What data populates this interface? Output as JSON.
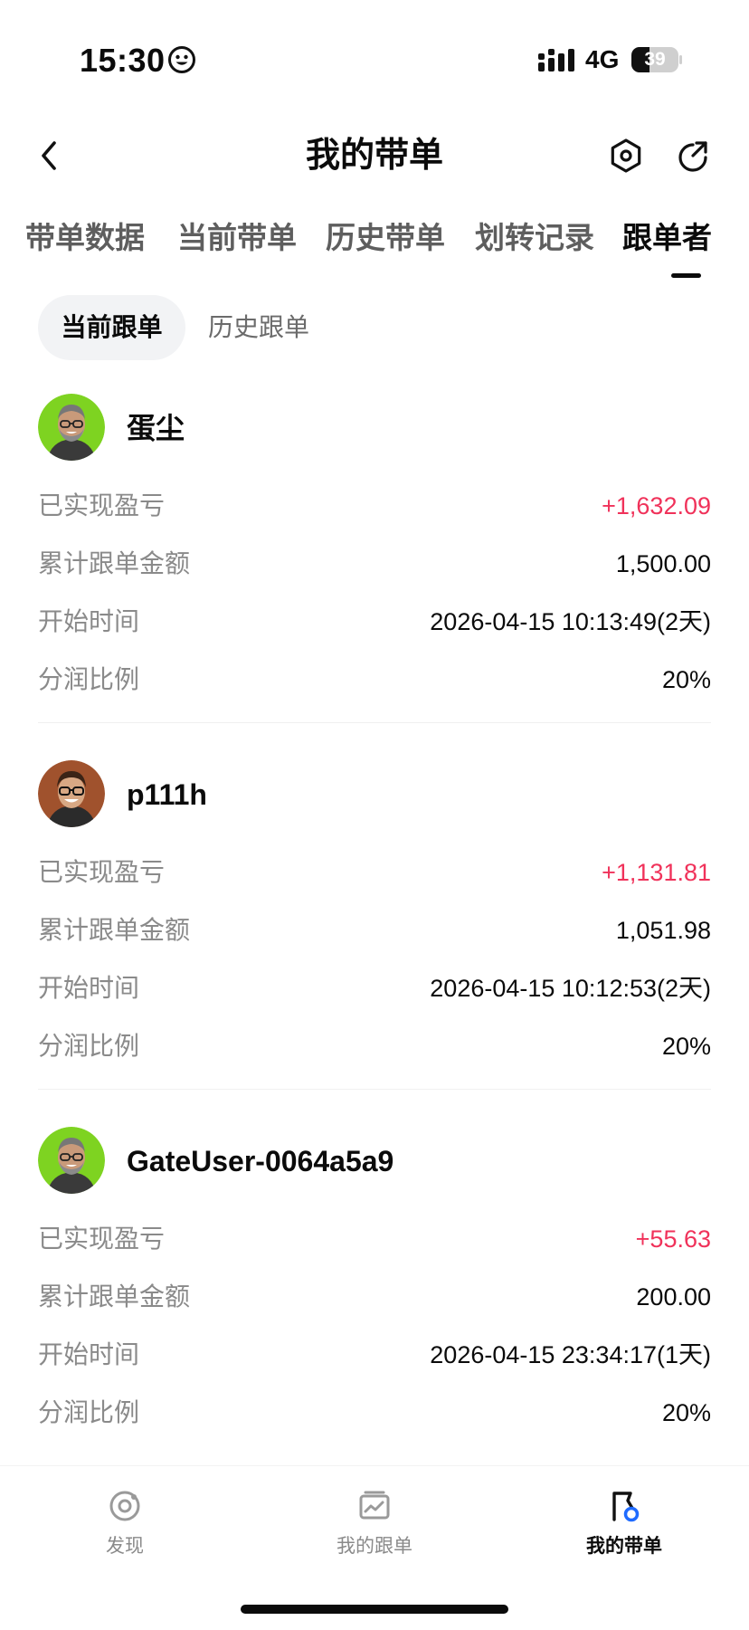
{
  "status_bar": {
    "time": "15:30",
    "network": "4G",
    "battery": "39",
    "battery_level": 0.39,
    "emoji_icon": "smiley-face-icon",
    "signal_icon": "cellular-signal-icon"
  },
  "header": {
    "title": "我的带单",
    "back_icon": "chevron-left-icon",
    "settings_icon": "hexagon-settings-icon",
    "share_icon": "share-arrow-icon"
  },
  "main_tabs": [
    {
      "label": "带单数据",
      "active": false
    },
    {
      "label": "当前带单",
      "active": false
    },
    {
      "label": "历史带单",
      "active": false
    },
    {
      "label": "划转记录",
      "active": false
    },
    {
      "label": "跟单者",
      "active": true
    }
  ],
  "sub_tabs": [
    {
      "label": "当前跟单",
      "active": true
    },
    {
      "label": "历史跟单",
      "active": false
    }
  ],
  "labels": {
    "pnl": "已实现盈亏",
    "amount": "累计跟单金额",
    "start_time": "开始时间",
    "share_ratio": "分润比例"
  },
  "followers": [
    {
      "name": "蛋尘",
      "avatar_bg": "#7ed321",
      "pnl": "+1,632.09",
      "amount": "1,500.00",
      "start_time": "2026-04-15 10:13:49(2天)",
      "share_ratio": "20%"
    },
    {
      "name": "p111h",
      "avatar_bg": "#a0522d",
      "pnl": "+1,131.81",
      "amount": "1,051.98",
      "start_time": "2026-04-15 10:12:53(2天)",
      "share_ratio": "20%"
    },
    {
      "name": "GateUser-0064a5a9",
      "avatar_bg": "#7ed321",
      "pnl": "+55.63",
      "amount": "200.00",
      "start_time": "2026-04-15 23:34:17(1天)",
      "share_ratio": "20%"
    }
  ],
  "bottom_nav": [
    {
      "label": "发现",
      "icon": "discover-target-icon",
      "active": false
    },
    {
      "label": "我的跟单",
      "icon": "chart-card-icon",
      "active": false
    },
    {
      "label": "我的带单",
      "icon": "flag-badge-icon",
      "active": true
    }
  ],
  "colors": {
    "profit": "#f0325a",
    "accent_blue": "#1f6bff",
    "text_primary": "#0b0b0b",
    "text_secondary": "#8a8a8a",
    "sub_tab_bg": "#f2f3f5"
  }
}
